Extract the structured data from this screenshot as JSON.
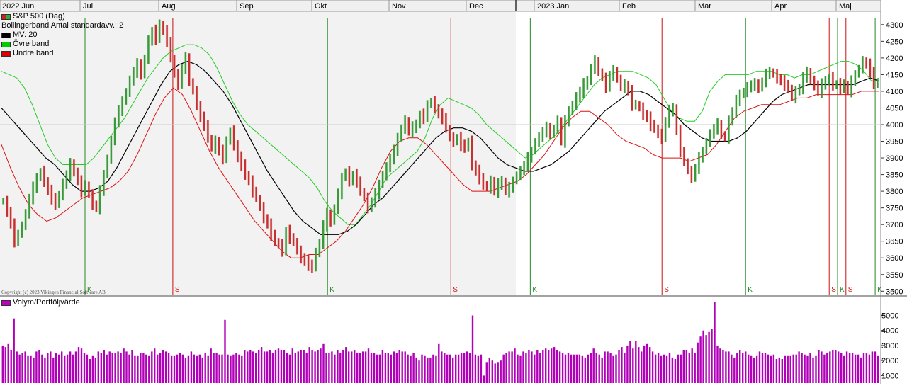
{
  "copyright": "Copyright (c) 2023 Vikingen Financial Software AB",
  "legend_top": [
    {
      "label": "S&P 500 (Dag)",
      "color": "#cc2222",
      "color2": "#33aa33"
    },
    {
      "label": "Bollingerband  Antal standardavv.: 2",
      "color": null
    },
    {
      "label": "MV: 20",
      "color": "#000000"
    },
    {
      "label": "Övre band",
      "color": "#00cc00"
    },
    {
      "label": "Undre band",
      "color": "#dd0000"
    }
  ],
  "legend_bottom": {
    "label": "Volym/Portföljvärde",
    "color": "#c000c0"
  },
  "colors": {
    "up": "#3a9a3a",
    "down": "#c83030",
    "upper": "#22cc22",
    "lower": "#dd1111",
    "ma": "#000000",
    "volume": "#b000b8"
  },
  "chart_data": [
    {
      "type": "bar",
      "subtype": "ohlc",
      "title": "",
      "series_name": "S&P 500 (Dag)",
      "x_labels": [
        "2022 Jun",
        "Jul",
        "Aug",
        "Sep",
        "Okt",
        "Nov",
        "Dec",
        "2023 Jan",
        "Feb",
        "Mar",
        "Apr",
        "Maj"
      ],
      "ylim": [
        3490,
        4340
      ],
      "y_ticks": [
        "3500",
        "3550",
        "3600",
        "3650",
        "3700",
        "3750",
        "3800",
        "3850",
        "3900",
        "3950",
        "4000",
        "4050",
        "4100",
        "4150",
        "4200",
        "4250",
        "4300"
      ],
      "grid": "horizontal at 4000",
      "closes": [
        3770,
        3740,
        3700,
        3650,
        3670,
        3700,
        3730,
        3780,
        3810,
        3840,
        3860,
        3830,
        3800,
        3780,
        3760,
        3790,
        3820,
        3850,
        3880,
        3860,
        3830,
        3800,
        3820,
        3790,
        3760,
        3750,
        3800,
        3850,
        3900,
        3950,
        4010,
        4040,
        4070,
        4100,
        4130,
        4160,
        4180,
        4150,
        4200,
        4250,
        4280,
        4260,
        4300,
        4280,
        4250,
        4200,
        4150,
        4120,
        4170,
        4200,
        4130,
        4100,
        4060,
        4020,
        4000,
        3960,
        3930,
        3950,
        3920,
        3900,
        3950,
        3980,
        3940,
        3900,
        3880,
        3850,
        3830,
        3800,
        3780,
        3750,
        3720,
        3700,
        3670,
        3650,
        3640,
        3620,
        3680,
        3660,
        3650,
        3620,
        3600,
        3590,
        3580,
        3570,
        3620,
        3640,
        3700,
        3730,
        3710,
        3750,
        3790,
        3840,
        3860,
        3830,
        3850,
        3830,
        3800,
        3780,
        3750,
        3770,
        3790,
        3820,
        3850,
        3870,
        3900,
        3920,
        3960,
        3990,
        4010,
        3980,
        3990,
        4000,
        4030,
        4020,
        4060,
        4070,
        4050,
        4030,
        4020,
        3990,
        3960,
        3950,
        3960,
        3940,
        3930,
        3950,
        3880,
        3860,
        3840,
        3820,
        3810,
        3830,
        3800,
        3820,
        3830,
        3800,
        3810,
        3830,
        3850,
        3860,
        3880,
        3900,
        3920,
        3950,
        3960,
        3980,
        3990,
        3970,
        3990,
        4010,
        3950,
        4010,
        4040,
        4060,
        4080,
        4100,
        4120,
        4130,
        4170,
        4190,
        4160,
        4140,
        4110,
        4150,
        4160,
        4140,
        4110,
        4120,
        4100,
        4060,
        4060,
        4050,
        4030,
        4020,
        4000,
        3990,
        3970,
        3960,
        4010,
        4040,
        4050,
        3980,
        3920,
        3890,
        3860,
        3840,
        3870,
        3900,
        3920,
        3950,
        3970,
        3990,
        4000,
        3970,
        3960,
        4010,
        4040,
        4070,
        4090,
        4100,
        4110,
        4120,
        4120,
        4110,
        4130,
        4150,
        4160,
        4150,
        4140,
        4130,
        4120,
        4110,
        4080,
        4100,
        4110,
        4140,
        4160,
        4130,
        4120,
        4100,
        4120,
        4130,
        4140,
        4120,
        4120,
        4110,
        4120,
        4100,
        4130,
        4150,
        4170,
        4190,
        4180,
        4160,
        4120,
        4130
      ],
      "upper_band": [
        4160,
        4150,
        4140,
        4110,
        4060,
        4000,
        3940,
        3900,
        3880,
        3880,
        3880,
        3880,
        3900,
        3930,
        3960,
        3990,
        4020,
        4060,
        4100,
        4140,
        4170,
        4200,
        4220,
        4230,
        4240,
        4240,
        4230,
        4210,
        4170,
        4120,
        4070,
        4030,
        4000,
        3980,
        3960,
        3940,
        3920,
        3900,
        3880,
        3860,
        3840,
        3810,
        3770,
        3740,
        3720,
        3700,
        3700,
        3730,
        3760,
        3800,
        3840,
        3860,
        3880,
        3900,
        3920,
        3960,
        4020,
        4060,
        4080,
        4070,
        4060,
        4050,
        4030,
        4000,
        3980,
        3960,
        3940,
        3920,
        3900,
        3910,
        3930,
        3950,
        3970,
        4000,
        4030,
        4060,
        4090,
        4120,
        4140,
        4150,
        4160,
        4160,
        4160,
        4150,
        4140,
        4120,
        4080,
        4040,
        4020,
        4010,
        4010,
        4040,
        4100,
        4130,
        4150,
        4150,
        4150,
        4150,
        4160,
        4160,
        4160,
        4150,
        4150,
        4140,
        4150,
        4150,
        4160,
        4170,
        4180,
        4190,
        4190,
        4180,
        4160,
        4130,
        4140
      ],
      "lower_band": [
        3940,
        3870,
        3810,
        3760,
        3730,
        3710,
        3720,
        3740,
        3760,
        3780,
        3790,
        3800,
        3810,
        3830,
        3860,
        3910,
        3970,
        4030,
        4080,
        4110,
        4090,
        4040,
        3980,
        3920,
        3870,
        3830,
        3790,
        3750,
        3710,
        3680,
        3650,
        3620,
        3600,
        3600,
        3610,
        3610,
        3630,
        3650,
        3680,
        3720,
        3760,
        3810,
        3870,
        3920,
        3950,
        3960,
        3960,
        3940,
        3910,
        3880,
        3850,
        3820,
        3800,
        3800,
        3800,
        3810,
        3820,
        3830,
        3850,
        3880,
        3910,
        3950,
        3990,
        4020,
        4040,
        4040,
        4020,
        4000,
        3970,
        3950,
        3940,
        3930,
        3910,
        3900,
        3900,
        3900,
        3890,
        3900,
        3910,
        3940,
        3980,
        4020,
        4040,
        4050,
        4060,
        4060,
        4060,
        4070,
        4080,
        4080,
        4090,
        4090,
        4090,
        4090,
        4090,
        4100,
        4100,
        4100
      ],
      "ma20": [
        4050,
        4020,
        3990,
        3960,
        3930,
        3900,
        3880,
        3850,
        3820,
        3800,
        3800,
        3810,
        3830,
        3870,
        3920,
        3970,
        4020,
        4070,
        4120,
        4160,
        4180,
        4190,
        4180,
        4160,
        4130,
        4100,
        4060,
        4010,
        3960,
        3910,
        3860,
        3820,
        3780,
        3740,
        3710,
        3690,
        3670,
        3670,
        3670,
        3680,
        3700,
        3730,
        3760,
        3780,
        3810,
        3840,
        3870,
        3900,
        3930,
        3960,
        3980,
        3990,
        3990,
        3980,
        3960,
        3930,
        3900,
        3880,
        3870,
        3860,
        3860,
        3870,
        3880,
        3900,
        3920,
        3950,
        3980,
        4010,
        4040,
        4060,
        4080,
        4100,
        4100,
        4090,
        4070,
        4050,
        4030,
        4000,
        3980,
        3960,
        3950,
        3950,
        3950,
        3960,
        3980,
        4010,
        4040,
        4070,
        4090,
        4100,
        4110,
        4120,
        4120,
        4120,
        4120,
        4120,
        4120,
        4130,
        4140,
        4130
      ]
    },
    {
      "type": "bar",
      "series_name": "Volym/Portföljvärde",
      "y_ticks": [
        "1000",
        "2000",
        "3000",
        "4000",
        "5000"
      ],
      "values": [
        3000,
        2900,
        3100,
        2700,
        4800,
        2600,
        2400,
        2500,
        2600,
        2300,
        2300,
        2200,
        2600,
        2700,
        2400,
        2200,
        2500,
        2600,
        2200,
        2500,
        2400,
        2600,
        2300,
        2400,
        2600,
        2400,
        2600,
        2900,
        2800,
        2500,
        2400,
        2100,
        2300,
        2200,
        2600,
        2500,
        2700,
        2400,
        2600,
        2500,
        2500,
        2600,
        2500,
        2800,
        2600,
        2400,
        2700,
        2300,
        2300,
        2500,
        2500,
        2400,
        2300,
        2600,
        2800,
        2400,
        2500,
        2700,
        2600,
        2500,
        2300,
        2300,
        2400,
        2500,
        2400,
        2200,
        2300,
        2600,
        2400,
        2300,
        2400,
        2200,
        2500,
        2300,
        2800,
        2500,
        2500,
        2400,
        2400,
        4700,
        2400,
        2300,
        2400,
        2500,
        2400,
        2300,
        2700,
        2600,
        2700,
        2600,
        2500,
        2700,
        2900,
        2600,
        2600,
        2700,
        2500,
        2700,
        2800,
        2700,
        2700,
        2500,
        2400,
        2800,
        2500,
        2600,
        2700,
        2700,
        2500,
        2900,
        2700,
        2600,
        2700,
        2800,
        3100,
        2500,
        2500,
        2600,
        2400,
        2700,
        2500,
        2700,
        2900,
        2600,
        2600,
        2700,
        2500,
        2500,
        2600,
        2600,
        2800,
        2500,
        2500,
        2400,
        2400,
        2700,
        2500,
        2500,
        2400,
        2600,
        2500,
        2700,
        2600,
        2600,
        2400,
        2300,
        2500,
        2200,
        2000,
        2400,
        2300,
        2200,
        2200,
        2400,
        2300,
        3100,
        2600,
        2500,
        2400,
        2400,
        2200,
        2400,
        2400,
        2500,
        2500,
        2600,
        2500,
        5000,
        2400,
        2300,
        2400,
        1000,
        1900,
        2200,
        2000,
        1800,
        1900,
        2000,
        2400,
        2500,
        2600,
        2600,
        2800,
        2400,
        2300,
        2600,
        2500,
        2700,
        2600,
        2400,
        2700,
        2500,
        2700,
        2800,
        2700,
        2800,
        2900,
        2700,
        2600,
        2500,
        2400,
        2500,
        2400,
        2400,
        2400,
        2400,
        2300,
        2200,
        2400,
        2500,
        2800,
        2500,
        2400,
        2200,
        2600,
        2600,
        2500,
        2300,
        2400,
        2700,
        2900,
        2500,
        3000,
        3300,
        2800,
        3300,
        2900,
        2600,
        3000,
        3100,
        2900,
        2600,
        2400,
        2500,
        2300,
        2400,
        2300,
        2500,
        2200,
        2100,
        2400,
        2400,
        2700,
        2700,
        2500,
        2800,
        2500,
        3200,
        3600,
        4000,
        3700,
        3900,
        4100,
        5900,
        3000,
        2800,
        2700,
        2600,
        2600,
        2400,
        2200,
        2500,
        2700,
        2500,
        2600,
        2400,
        2300,
        2200,
        2300,
        2600,
        2500,
        2500,
        2400,
        2300,
        2400,
        2100,
        2200,
        2100,
        2300,
        2300,
        2300,
        2400,
        2400,
        2600,
        2500,
        2400,
        2300,
        2500,
        2200,
        2300,
        2700,
        2600,
        2400,
        2500,
        2600,
        2700,
        2700,
        2600,
        2500,
        2300,
        2600,
        2500,
        2500,
        2400,
        2400,
        2200,
        2500,
        2500,
        2400,
        2600,
        2600,
        2300
      ]
    }
  ],
  "signals": [
    {
      "label": "K",
      "color": "#228822",
      "date_index": 40
    },
    {
      "label": "S",
      "color": "#cc1111",
      "date_index": 82
    },
    {
      "label": "K",
      "color": "#228822",
      "date_index": 156
    },
    {
      "label": "S",
      "color": "#cc1111",
      "date_index": 215
    },
    {
      "label": "K",
      "color": "#228822",
      "date_index": 253
    },
    {
      "label": "S",
      "color": "#cc1111",
      "date_index": 316
    },
    {
      "label": "K",
      "color": "#228822",
      "date_index": 356
    },
    {
      "label": "S",
      "color": "#cc1111",
      "date_index": 396
    },
    {
      "label": "K",
      "color": "#228822",
      "date_index": 400
    },
    {
      "label": "S",
      "color": "#cc1111",
      "date_index": 404
    },
    {
      "label": "K",
      "color": "#228822",
      "date_index": 418
    }
  ]
}
